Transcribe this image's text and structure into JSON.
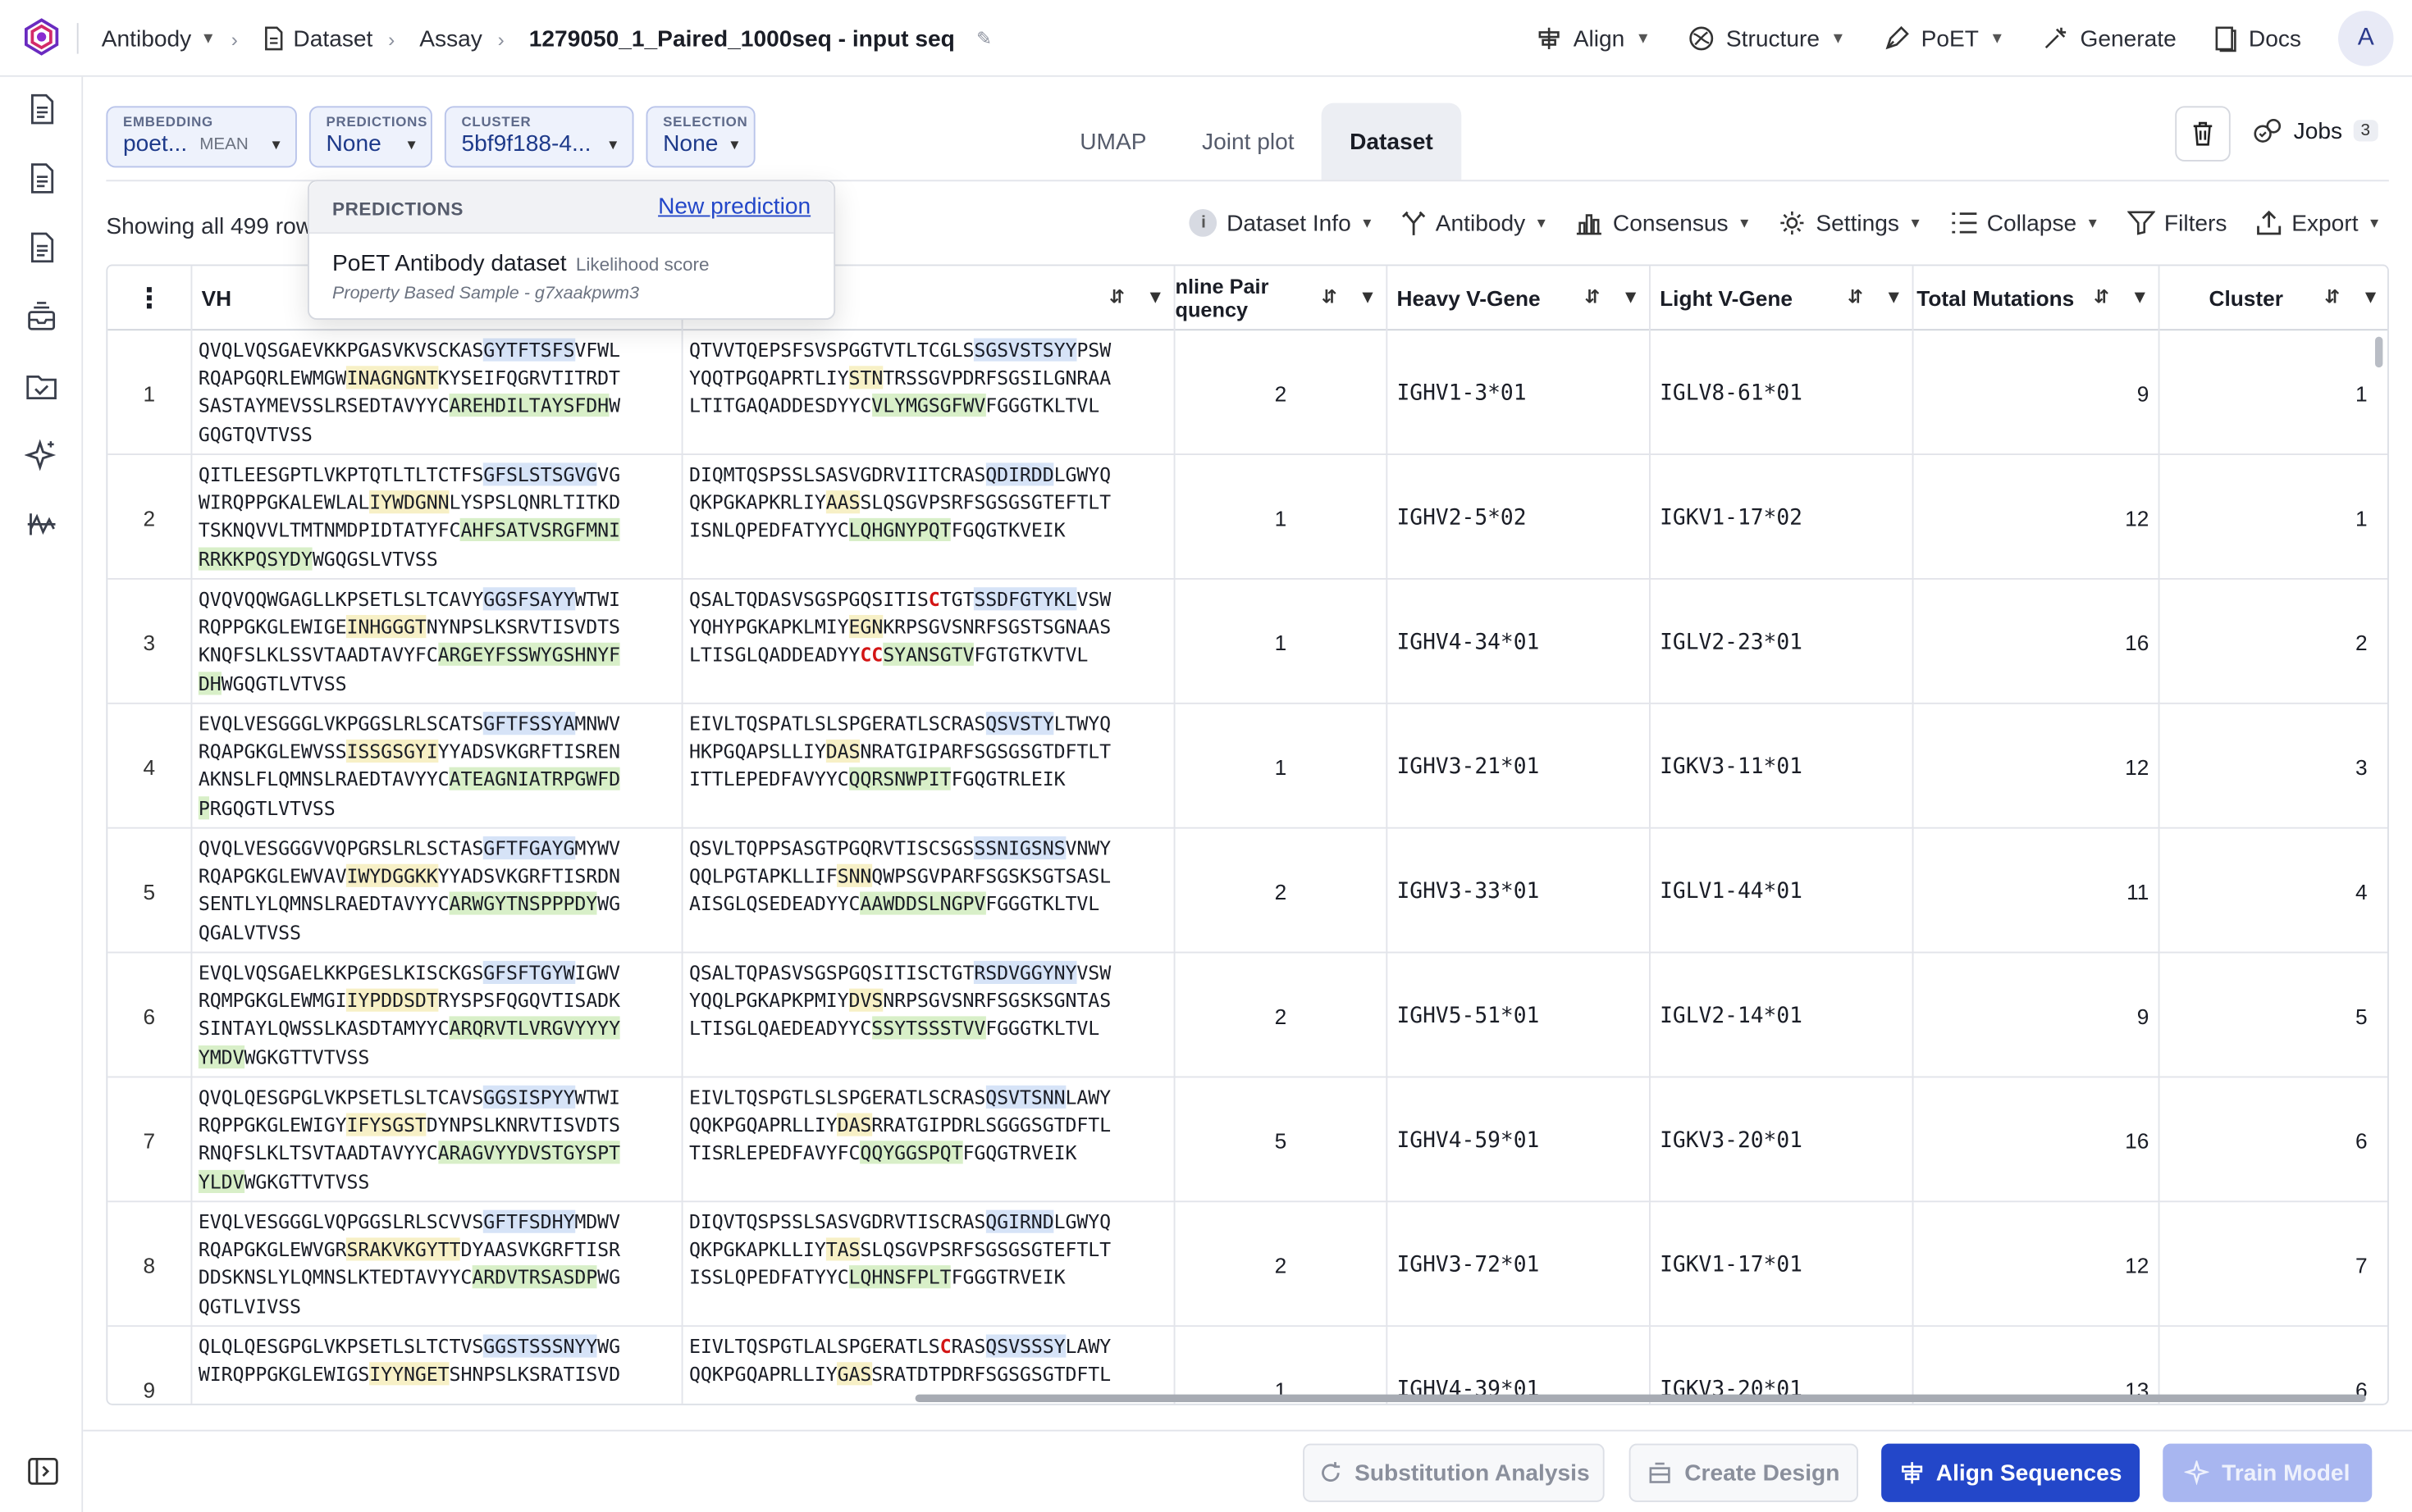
{
  "breadcrumb": {
    "antibody": "Antibody",
    "dataset": "Dataset",
    "assay": "Assay",
    "title": "1279050_1_Paired_1000seq - input seq"
  },
  "topnav": {
    "align": "Align",
    "structure": "Structure",
    "poet": "PoET",
    "generate": "Generate",
    "docs": "Docs",
    "avatar": "A"
  },
  "selectors": {
    "embedding": {
      "label": "EMBEDDING",
      "value": "poet...",
      "sub": "MEAN"
    },
    "predictions": {
      "label": "PREDICTIONS",
      "value": "None"
    },
    "cluster": {
      "label": "CLUSTER",
      "value": "5bf9f188-4..."
    },
    "selection": {
      "label": "SELECTION",
      "value": "None"
    }
  },
  "view_tabs": [
    "UMAP",
    "Joint plot",
    "Dataset"
  ],
  "jobs": {
    "label": "Jobs",
    "count": "3"
  },
  "showing": "Showing all 499 row",
  "toolbar": {
    "dataset_info": "Dataset Info",
    "antibody": "Antibody",
    "consensus": "Consensus",
    "settings": "Settings",
    "collapse": "Collapse",
    "filters": "Filters",
    "export": "Export"
  },
  "popover": {
    "title": "PREDICTIONS",
    "link": "New prediction",
    "model_name": "PoET Antibody dataset",
    "score": "Likelihood score",
    "sub": "Property Based Sample - g7xaakpwm3"
  },
  "table": {
    "columns": {
      "vh": "VH",
      "pair_frequency": "nline Pair\nquency",
      "heavy_vgene": "Heavy V-Gene",
      "light_vgene": "Light V-Gene",
      "total_mutations": "Total Mutations",
      "cluster": "Cluster"
    },
    "rows": [
      {
        "idx": "1",
        "vh": [
          [
            "QVQLVQSGAEVKKPGASVKVSCKAS",
            ""
          ],
          [
            "GYTFTSFS",
            "b"
          ],
          [
            "VFWL\nRQAPGQRLEWMGW",
            ""
          ],
          [
            "INAGNGNT",
            "y"
          ],
          [
            "KYSEIFQGRVTITRDT\nSASTAYMEVSSLRSEDTAVYYC",
            ""
          ],
          [
            "AREHDILTAYSFDH",
            "g"
          ],
          [
            "W\nGQGTQVTVSS",
            ""
          ]
        ],
        "vl": [
          [
            "QTVVTQEPSFSVSPGGTVTLTCGLS",
            ""
          ],
          [
            "SGSVSTSYY",
            "b"
          ],
          [
            "PSW\nYQQTPGQAPRTLIY",
            ""
          ],
          [
            "STN",
            "y"
          ],
          [
            "TRSSGVPDRFSGSILGNRAA\nLTITGAQADDESDYYC",
            ""
          ],
          [
            "VLYMGSGFWV",
            "g"
          ],
          [
            "FGGGTKLTVL",
            ""
          ]
        ],
        "pair": "2",
        "heavy": "IGHV1-3*01",
        "light": "IGLV8-61*01",
        "mut": "9",
        "cluster": "1"
      },
      {
        "idx": "2",
        "vh": [
          [
            "QITLEESGPTLVKPTQTLTLTCTFS",
            ""
          ],
          [
            "GFSLSTSGVG",
            "b"
          ],
          [
            "VG\nWIRQPPGKALEWLAL",
            ""
          ],
          [
            "IYWDGNN",
            "y"
          ],
          [
            "LYSPSLQNRLTITKD\nTSKNQVVLTMTNMDPIDTATYFC",
            ""
          ],
          [
            "AHFSATVSRGFMNI\nRRKKPQSYDY",
            "g"
          ],
          [
            "WGQGSLVTVSS",
            ""
          ]
        ],
        "vl": [
          [
            "DIQMTQSPSSLSASVGDRVIITCRAS",
            ""
          ],
          [
            "QDIRDD",
            "b"
          ],
          [
            "LGWYQ\nQKPGKAPKRLIY",
            ""
          ],
          [
            "AAS",
            "y"
          ],
          [
            "SLQSGVPSRFSGSGSGTEFTLT\nISNLQPEDFATYYC",
            ""
          ],
          [
            "LQHGNYPQT",
            "g"
          ],
          [
            "FGQGTKVEIK",
            ""
          ]
        ],
        "pair": "1",
        "heavy": "IGHV2-5*02",
        "light": "IGKV1-17*02",
        "mut": "12",
        "cluster": "1"
      },
      {
        "idx": "3",
        "vh": [
          [
            "QVQVQQWGAGLLKPSETLSLTCAVY",
            ""
          ],
          [
            "GGSFSAYY",
            "b"
          ],
          [
            "WTWI\nRQPPGKGLEWIGE",
            ""
          ],
          [
            "INHGGGT",
            "y"
          ],
          [
            "NYNPSLKSRVTISVDTS\nKNQFSLKLSSVTAADTAVYFC",
            ""
          ],
          [
            "ARGEYFSSWYGSHNYF\nDH",
            "g"
          ],
          [
            "WGQGTLVTVSS",
            ""
          ]
        ],
        "vl": [
          [
            "QSALTQDASVSGSPGQSITIS",
            ""
          ],
          [
            "C",
            "r"
          ],
          [
            "TGT",
            ""
          ],
          [
            "SSDFGTYKL",
            "b"
          ],
          [
            "VSW\nYQHYPGKAPKLMIY",
            ""
          ],
          [
            "EGN",
            "y"
          ],
          [
            "KRPSGVSNRFSGSTSGNAAS\nLTISGLQADDEADYY",
            ""
          ],
          [
            "CC",
            "r"
          ],
          [
            "SYANSGTV",
            "g"
          ],
          [
            "FGTGTKVTVL",
            ""
          ]
        ],
        "pair": "1",
        "heavy": "IGHV4-34*01",
        "light": "IGLV2-23*01",
        "mut": "16",
        "cluster": "2"
      },
      {
        "idx": "4",
        "vh": [
          [
            "EVQLVESGGGLVKPGGSLRLSCATS",
            ""
          ],
          [
            "GFTFSSYA",
            "b"
          ],
          [
            "MNWV\nRQAPGKGLEWVSS",
            ""
          ],
          [
            "ISSGSGYI",
            "y"
          ],
          [
            "YYADSVKGRFTISREN\nAKNSLFLQMNSLRAEDTAVYYC",
            ""
          ],
          [
            "ATEAGNIATRPGWFD\nP",
            "g"
          ],
          [
            "RGQGTLVTVSS",
            ""
          ]
        ],
        "vl": [
          [
            "EIVLTQSPATLSLSPGERATLSCRAS",
            ""
          ],
          [
            "QSVSTY",
            "b"
          ],
          [
            "LTWYQ\nHKPGQAPSLLIY",
            ""
          ],
          [
            "DAS",
            "y"
          ],
          [
            "NRATGIPARFSGSGSGTDFTLT\nITTLEPEDFAVYYC",
            ""
          ],
          [
            "QQRSNWPIT",
            "g"
          ],
          [
            "FGQGTRLEIK",
            ""
          ]
        ],
        "pair": "1",
        "heavy": "IGHV3-21*01",
        "light": "IGKV3-11*01",
        "mut": "12",
        "cluster": "3"
      },
      {
        "idx": "5",
        "vh": [
          [
            "QVQLVESGGGVVQPGRSLRLSCTAS",
            ""
          ],
          [
            "GFTFGAYG",
            "b"
          ],
          [
            "MYWV\nRQAPGKGLEWVAV",
            ""
          ],
          [
            "IWYDGGKK",
            "y"
          ],
          [
            "YYADSVKGRFTISRDN\nSENTLYLQMNSLRAEDTAVYYC",
            ""
          ],
          [
            "ARWGYTNSPPPDY",
            "g"
          ],
          [
            "WG\nQGALVTVSS",
            ""
          ]
        ],
        "vl": [
          [
            "QSVLTQPPSASGTPGQRVTISCSGS",
            ""
          ],
          [
            "SSNIGSNS",
            "b"
          ],
          [
            "VNWY\nQQLPGTAPKLLIF",
            ""
          ],
          [
            "SNN",
            "y"
          ],
          [
            "QWPSGVPARFSGSKSGTSASL\nAISGLQSEDEADYYC",
            ""
          ],
          [
            "AAWDDSLNGPV",
            "g"
          ],
          [
            "FGGGTKLTVL",
            ""
          ]
        ],
        "pair": "2",
        "heavy": "IGHV3-33*01",
        "light": "IGLV1-44*01",
        "mut": "11",
        "cluster": "4"
      },
      {
        "idx": "6",
        "vh": [
          [
            "EVQLVQSGAELKKPGESLKISCKGS",
            ""
          ],
          [
            "GFSFTGYW",
            "b"
          ],
          [
            "IGWV\nRQMPGKGLEWMGI",
            ""
          ],
          [
            "IYPDDSDT",
            "y"
          ],
          [
            "RYSPSFQGQVTISADK\nSINTAYLQWSSLKASDTAMYYC",
            ""
          ],
          [
            "ARQRVTLVRGVYYYY\nYMDV",
            "g"
          ],
          [
            "WGKGTTVTVSS",
            ""
          ]
        ],
        "vl": [
          [
            "QSALTQPASVSGSPGQSITISCTGT",
            ""
          ],
          [
            "RSDVGGYNY",
            "b"
          ],
          [
            "VSW\nYQQLPGKAPKPMIY",
            ""
          ],
          [
            "DVS",
            "y"
          ],
          [
            "NRPSGVSNRFSGSKSGNTAS\nLTISGLQAEDEADYYC",
            ""
          ],
          [
            "SSYTSSSTVV",
            "g"
          ],
          [
            "FGGGTKLTVL",
            ""
          ]
        ],
        "pair": "2",
        "heavy": "IGHV5-51*01",
        "light": "IGLV2-14*01",
        "mut": "9",
        "cluster": "5"
      },
      {
        "idx": "7",
        "vh": [
          [
            "QVQLQESGPGLVKPSETLSLTCAVS",
            ""
          ],
          [
            "GGSISPYY",
            "b"
          ],
          [
            "WTWI\nRQPPGKGLEWIGY",
            ""
          ],
          [
            "IFYSGST",
            "y"
          ],
          [
            "DYNPSLKNRVTISVDTS\nRNQFSLKLTSVTAADTAVYYC",
            ""
          ],
          [
            "ARAGVYYDVSTGYSPT\nYLDV",
            "g"
          ],
          [
            "WGKGTTVTVSS",
            ""
          ]
        ],
        "vl": [
          [
            "EIVLTQSPGTLSLSPGERATLSCRAS",
            ""
          ],
          [
            "QSVTSNN",
            "b"
          ],
          [
            "LAWY\nQQKPGQAPRLLIY",
            ""
          ],
          [
            "DAS",
            "y"
          ],
          [
            "RRATGIPDRLSGGGSGTDFTL\nTISRLEPEDFAVYFC",
            ""
          ],
          [
            "QQYGGSPQT",
            "g"
          ],
          [
            "FGQGTRVEIK",
            ""
          ]
        ],
        "pair": "5",
        "heavy": "IGHV4-59*01",
        "light": "IGKV3-20*01",
        "mut": "16",
        "cluster": "6"
      },
      {
        "idx": "8",
        "vh": [
          [
            "EVQLVESGGGLVQPGGSLRLSCVVS",
            ""
          ],
          [
            "GFTFSDHY",
            "b"
          ],
          [
            "MDWV\nRQAPGKGLEWVGR",
            ""
          ],
          [
            "SRAKVKGYTT",
            "y"
          ],
          [
            "DYAASVKGRFTISR\nDDSKNSLYLQMNSLKTEDTAVYYC",
            ""
          ],
          [
            "ARDVTRSASDP",
            "g"
          ],
          [
            "WG\nQGTLVIVSS",
            ""
          ]
        ],
        "vl": [
          [
            "DIQVTQSPSSLSASVGDRVTISCRAS",
            ""
          ],
          [
            "QGIRND",
            "b"
          ],
          [
            "LGWYQ\nQKPGKAPKLLIY",
            ""
          ],
          [
            "TAS",
            "y"
          ],
          [
            "SLQSGVPSRFSGSGSGTEFTLT\nISSLQPEDFATYYC",
            ""
          ],
          [
            "LQHNSFPLT",
            "g"
          ],
          [
            "FGGGTRVEIK",
            ""
          ]
        ],
        "pair": "2",
        "heavy": "IGHV3-72*01",
        "light": "IGKV1-17*01",
        "mut": "12",
        "cluster": "7"
      },
      {
        "idx": "9",
        "vh": [
          [
            "QLQLQESGPGLVKPSETLSLTCTVS",
            ""
          ],
          [
            "GGSTSSSNYY",
            "b"
          ],
          [
            "WG\nWIRQPPGKGLEWIGS",
            ""
          ],
          [
            "IYYNGET",
            "y"
          ],
          [
            "SHNPSLKSRATISVD",
            ""
          ]
        ],
        "vl": [
          [
            "EIVLTQSPGTLALSPGERATLS",
            ""
          ],
          [
            "C",
            "r"
          ],
          [
            "RAS",
            ""
          ],
          [
            "QSVSSSY",
            "b"
          ],
          [
            "LAWY\nQQKPGQAPRLLIY",
            ""
          ],
          [
            "GAS",
            "y"
          ],
          [
            "SRATDTPDRFSGSGSGTDFTL",
            ""
          ]
        ],
        "pair": "1",
        "heavy": "IGHV4-39*01",
        "light": "IGKV3-20*01",
        "mut": "13",
        "cluster": "6"
      }
    ]
  },
  "bottom": {
    "substitution": "Substitution Analysis",
    "create_design": "Create Design",
    "align": "Align Sequences",
    "train": "Train Model"
  }
}
